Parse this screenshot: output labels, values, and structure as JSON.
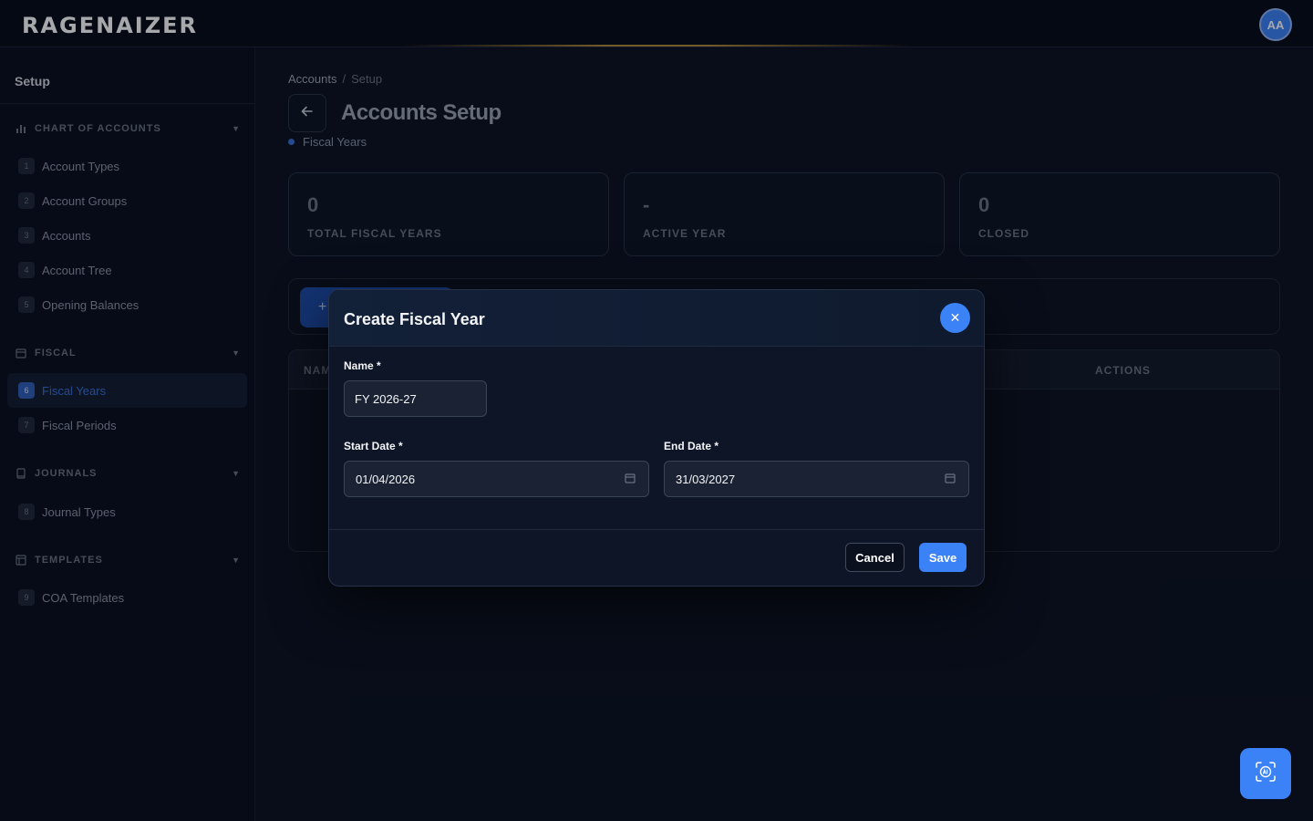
{
  "header": {
    "logo_text": "RAGENAIZER",
    "avatar_initials": "AA"
  },
  "sidebar": {
    "title": "Setup",
    "sections": [
      {
        "label": "CHART OF ACCOUNTS",
        "icon": "bar-chart-icon"
      },
      {
        "label": "FISCAL",
        "icon": "calendar-icon"
      },
      {
        "label": "JOURNALS",
        "icon": "book-icon"
      },
      {
        "label": "TEMPLATES",
        "icon": "layout-icon"
      }
    ],
    "items": [
      {
        "num": "1",
        "label": "Account Types"
      },
      {
        "num": "2",
        "label": "Account Groups"
      },
      {
        "num": "3",
        "label": "Accounts"
      },
      {
        "num": "4",
        "label": "Account Tree"
      },
      {
        "num": "5",
        "label": "Opening Balances"
      },
      {
        "num": "6",
        "label": "Fiscal Years"
      },
      {
        "num": "7",
        "label": "Fiscal Periods"
      },
      {
        "num": "8",
        "label": "Journal Types"
      },
      {
        "num": "9",
        "label": "COA Templates"
      }
    ],
    "active_item": "Fiscal Years"
  },
  "main": {
    "breadcrumb": [
      "Accounts",
      "/",
      "Setup"
    ],
    "title": "Accounts Setup",
    "subtag": "Fiscal Years",
    "stats": [
      {
        "value": "0",
        "label": "TOTAL FISCAL YEARS"
      },
      {
        "value": "-",
        "label": "ACTIVE YEAR"
      },
      {
        "value": "0",
        "label": "CLOSED"
      }
    ],
    "add_button_icon": "+",
    "table_headers": {
      "name": "NAM",
      "actions": "ACTIONS"
    }
  },
  "modal": {
    "title": "Create Fiscal Year",
    "close_symbol": "✕",
    "name_label": "Name *",
    "name_value": "FY 2026-27",
    "start_label": "Start Date *",
    "start_value": "01/04/2026",
    "end_label": "End Date *",
    "end_value": "31/03/2027",
    "cancel_label": "Cancel",
    "save_label": "Save"
  },
  "colors": {
    "accent": "#3b82f6",
    "background": "#0b1120",
    "active_nav": "#3b6fd4"
  }
}
